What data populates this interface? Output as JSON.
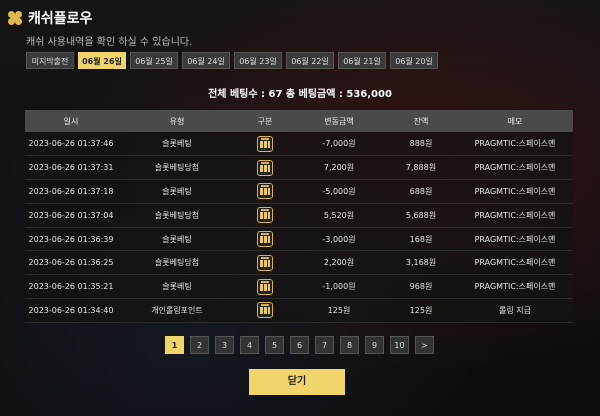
{
  "header": {
    "title": "캐쉬플로우",
    "subtitle": "캐쉬 사용내역을 확인 하실 수 있습니다."
  },
  "tabs": [
    {
      "label": "미지막출전",
      "active": false
    },
    {
      "label": "06월 26일",
      "active": true
    },
    {
      "label": "06월 25일",
      "active": false
    },
    {
      "label": "06월 24일",
      "active": false
    },
    {
      "label": "06월 23일",
      "active": false
    },
    {
      "label": "06월 22일",
      "active": false
    },
    {
      "label": "06월 21일",
      "active": false
    },
    {
      "label": "06월 20일",
      "active": false
    }
  ],
  "summary": "전체 베팅수 : 67   총 베팅금액 : 536,000",
  "table": {
    "headers": [
      "일시",
      "유형",
      "구분",
      "변동금액",
      "잔액",
      "메모"
    ],
    "rows": [
      {
        "date": "2023-06-26 01:37:46",
        "type": "슬롯베팅",
        "icon": "slot-icon",
        "amount": "-7,000원",
        "sign": "neg",
        "balance": "888원",
        "memo": "PRAGMTIC:스페이스맨"
      },
      {
        "date": "2023-06-26 01:37:31",
        "type": "슬롯베팅당첨",
        "icon": "slot-icon",
        "amount": "7,200원",
        "sign": "pos",
        "balance": "7,888원",
        "memo": "PRAGMTIC:스페이스맨"
      },
      {
        "date": "2023-06-26 01:37:18",
        "type": "슬롯베팅",
        "icon": "slot-icon",
        "amount": "-5,000원",
        "sign": "neg",
        "balance": "688원",
        "memo": "PRAGMTIC:스페이스맨"
      },
      {
        "date": "2023-06-26 01:37:04",
        "type": "슬롯베팅당첨",
        "icon": "slot-icon",
        "amount": "5,520원",
        "sign": "pos",
        "balance": "5,688원",
        "memo": "PRAGMTIC:스페이스맨"
      },
      {
        "date": "2023-06-26 01:36:39",
        "type": "슬롯베팅",
        "icon": "slot-icon",
        "amount": "-3,000원",
        "sign": "neg",
        "balance": "168원",
        "memo": "PRAGMTIC:스페이스맨"
      },
      {
        "date": "2023-06-26 01:36:25",
        "type": "슬롯베팅당첨",
        "icon": "slot-icon",
        "amount": "2,200원",
        "sign": "pos",
        "balance": "3,168원",
        "memo": "PRAGMTIC:스페이스맨"
      },
      {
        "date": "2023-06-26 01:35:21",
        "type": "슬롯베팅",
        "icon": "slot-icon",
        "amount": "-1,000원",
        "sign": "neg",
        "balance": "968원",
        "memo": "PRAGMTIC:스페이스맨"
      },
      {
        "date": "2023-06-26 01:34:40",
        "type": "개인롤링포인트",
        "icon": "slot-icon",
        "amount": "125원",
        "sign": "pos",
        "balance": "125원",
        "memo": "롤링 지급"
      }
    ]
  },
  "pagination": {
    "pages": [
      "1",
      "2",
      "3",
      "4",
      "5",
      "6",
      "7",
      "8",
      "9",
      "10",
      ">"
    ],
    "active": "1"
  },
  "close_label": "닫기",
  "colors": {
    "accent": "#f1d46a",
    "negative": "#d23a3a",
    "positive": "#4a8fe0"
  }
}
